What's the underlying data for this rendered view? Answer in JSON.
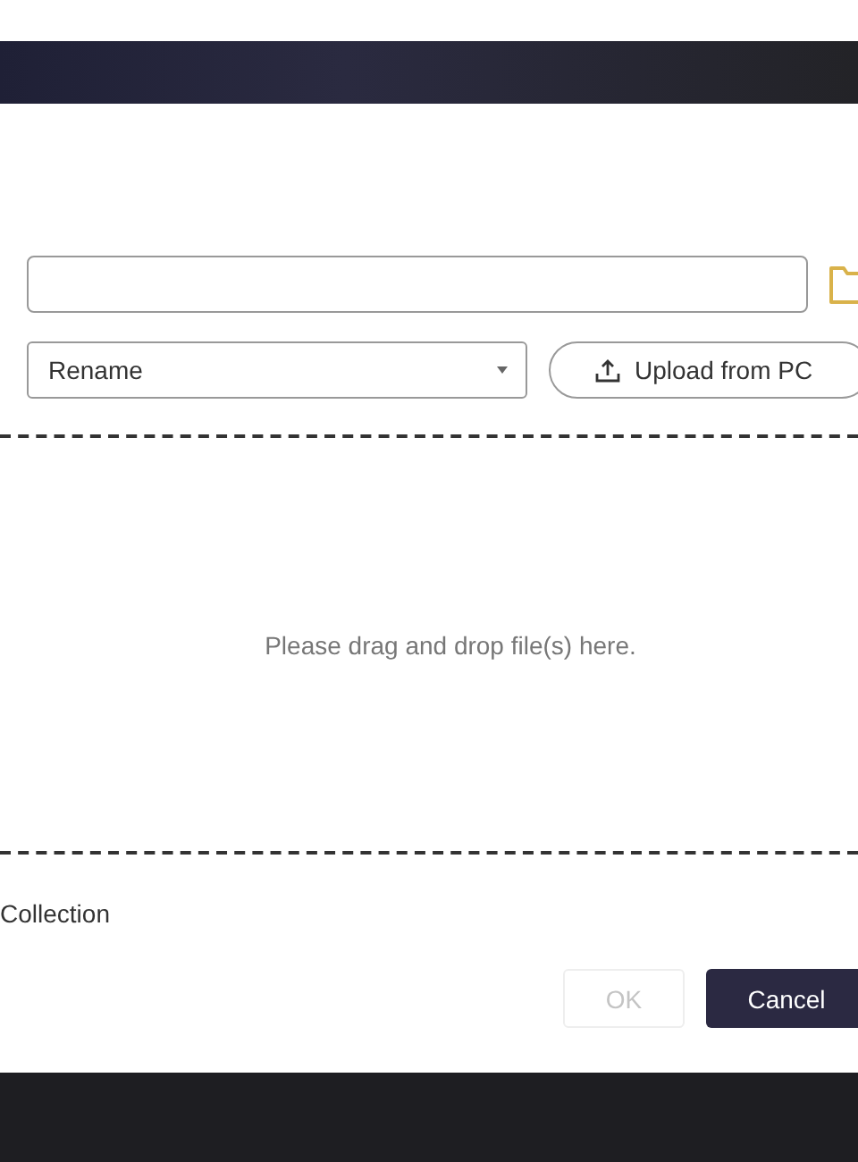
{
  "conflict_select": {
    "value": "Rename"
  },
  "upload_button": {
    "label": "Upload from PC"
  },
  "drop_zone": {
    "message": "Please drag and drop file(s) here."
  },
  "collection_label": "Collection",
  "buttons": [
    {
      "label": "OK",
      "kind": "secondary",
      "disabled": true
    },
    {
      "label": "Cancel",
      "kind": "primary",
      "disabled": false
    }
  ]
}
